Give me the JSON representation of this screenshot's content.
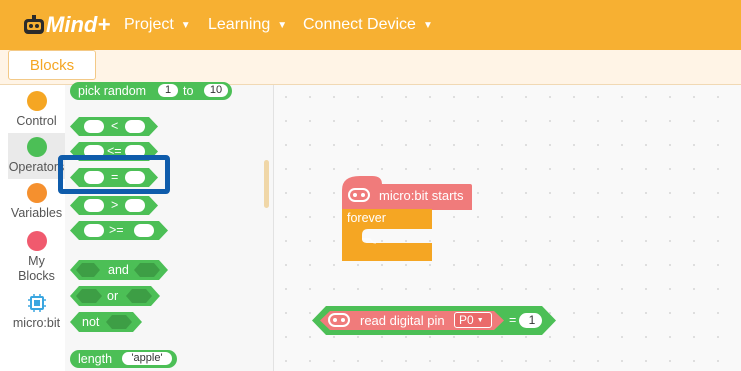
{
  "app": {
    "logo_text": "Mind+"
  },
  "menu": [
    {
      "label": "Project"
    },
    {
      "label": "Learning"
    },
    {
      "label": "Connect Device"
    }
  ],
  "tabs": {
    "blocks": "Blocks"
  },
  "categories": [
    {
      "label": "Control",
      "color": "#f5a623"
    },
    {
      "label": "Operators",
      "color": "#4cbf56"
    },
    {
      "label": "Variables",
      "color": "#f5902e"
    },
    {
      "label": "My Blocks",
      "color": "#f05a6e"
    },
    {
      "label": "micro:bit",
      "color": "#3aa6e0"
    }
  ],
  "palette": {
    "pick_random": {
      "label": "pick random",
      "from": "1",
      "to_label": "to",
      "to": "10"
    },
    "lt": "<",
    "le": "<=",
    "eq": "=",
    "gt": ">",
    "ge": ">=",
    "and": "and",
    "or": "or",
    "not": "not",
    "length": {
      "label": "length",
      "value": "'apple'"
    }
  },
  "workspace": {
    "start_block": "micro:bit starts",
    "forever_block": "forever",
    "compare_block": {
      "label": "read digital pin",
      "pin": "P0",
      "op": "=",
      "value": "1"
    }
  },
  "colors": {
    "accent": "#f7b032",
    "operators": "#4cbf56",
    "microbit_block": "#f07b7b",
    "control": "#f5a623",
    "highlight": "#0f5cab"
  }
}
